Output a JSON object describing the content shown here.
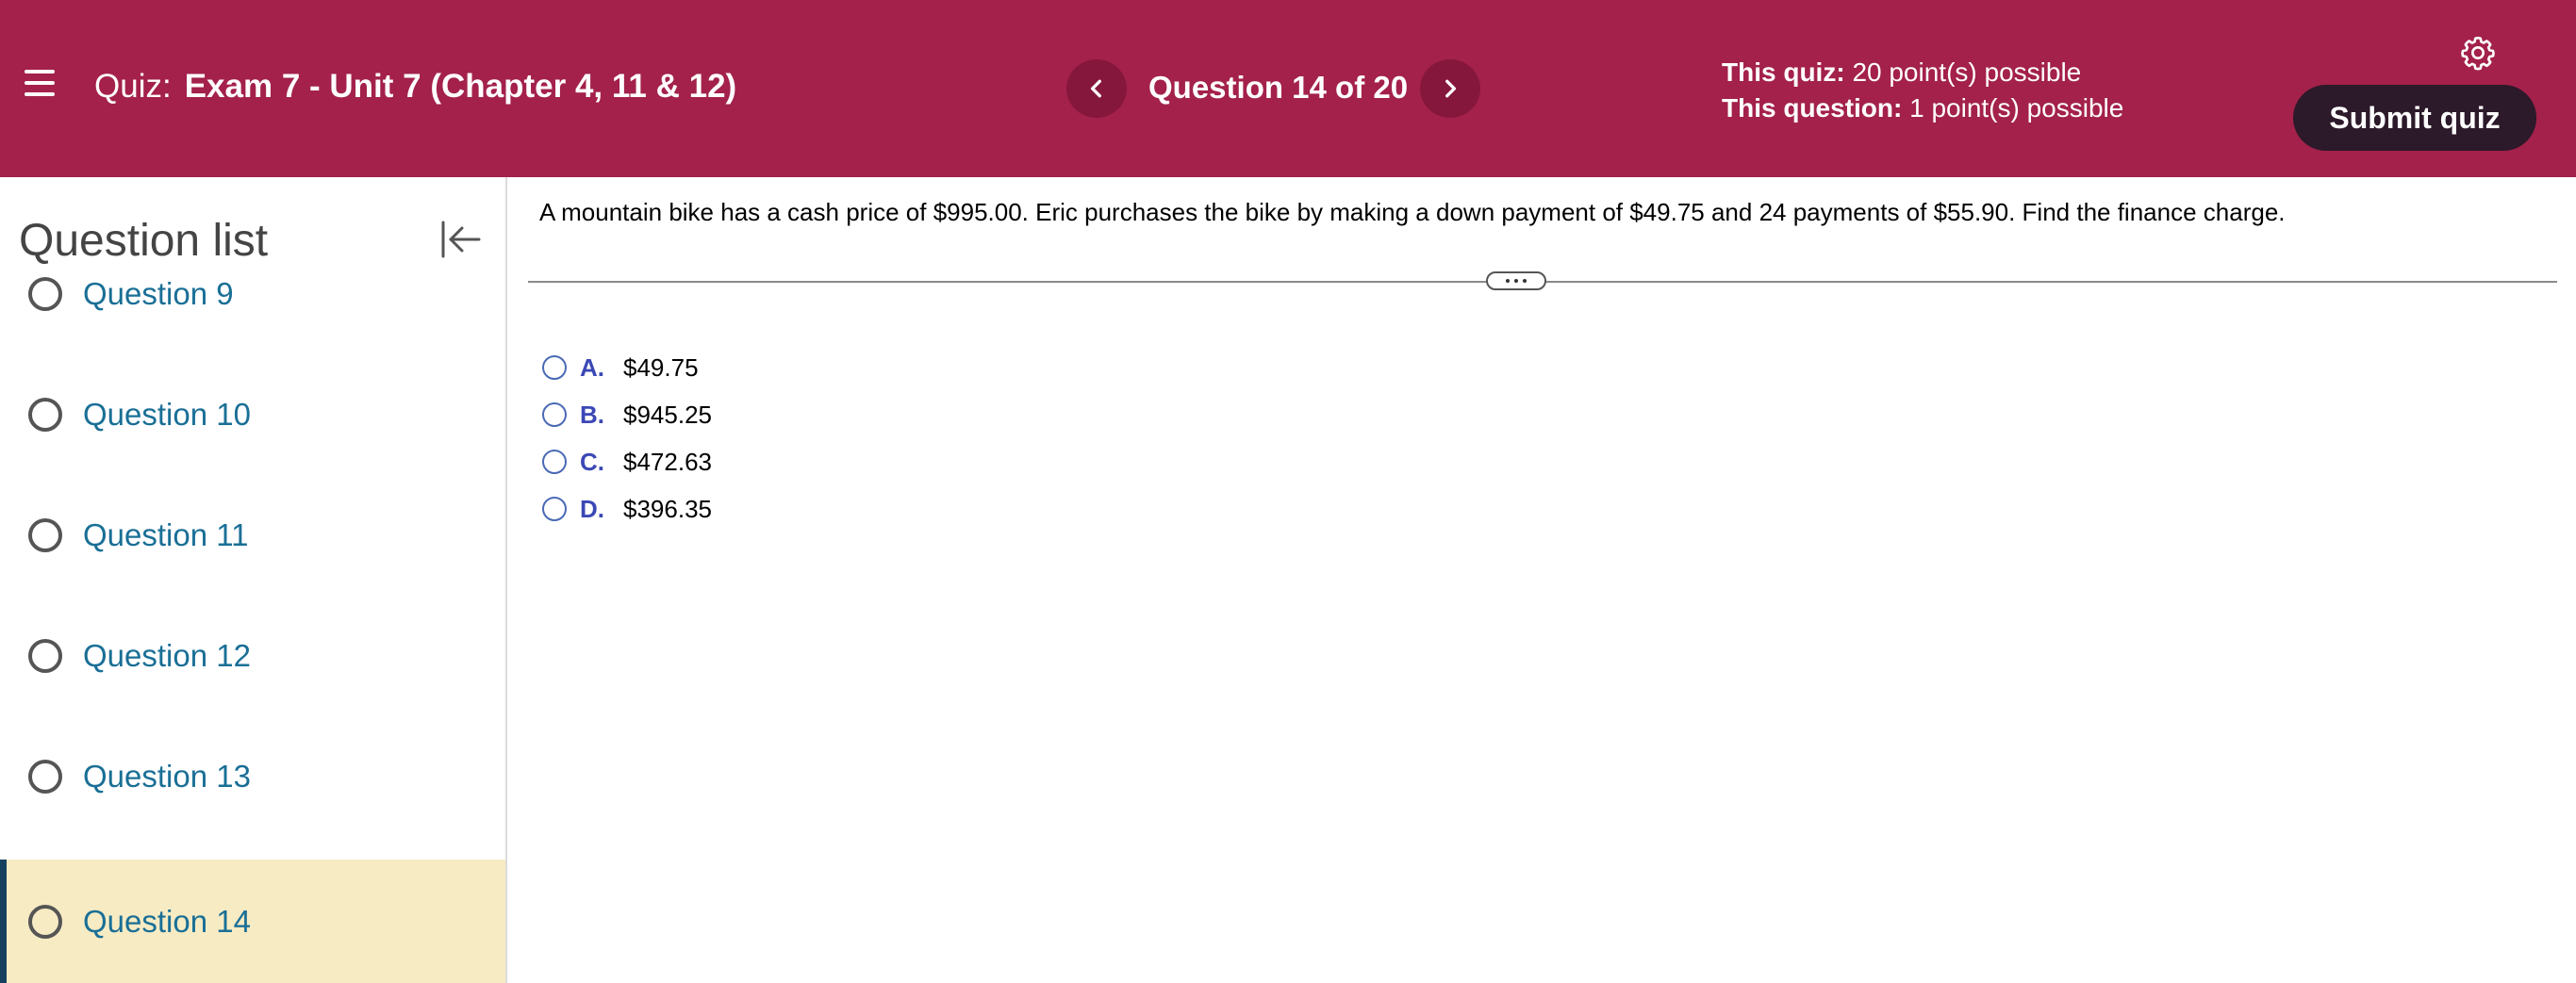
{
  "header": {
    "quiz_prefix": "Quiz:",
    "quiz_name": "Exam 7 - Unit 7 (Chapter 4, 11 & 12)",
    "question_counter": "Question 14 of 20",
    "this_quiz_label": "This quiz:",
    "this_quiz_value": "20 point(s) possible",
    "this_question_label": "This question:",
    "this_question_value": "1 point(s) possible",
    "submit_label": "Submit quiz",
    "colors": {
      "bar": "#a3214b",
      "nav_button": "#86173c",
      "submit": "#2c1929"
    }
  },
  "sidebar": {
    "title": "Question list",
    "items": [
      {
        "label": "Question 9"
      },
      {
        "label": "Question 10"
      },
      {
        "label": "Question 11"
      },
      {
        "label": "Question 12"
      },
      {
        "label": "Question 13"
      },
      {
        "label": "Question 14",
        "active": true
      }
    ]
  },
  "main": {
    "question": "A mountain bike has a cash price of $995.00. Eric purchases the bike by making a down payment of $49.75 and 24 payments of $55.90. Find the finance charge.",
    "options": [
      {
        "letter": "A.",
        "value": "$49.75"
      },
      {
        "letter": "B.",
        "value": "$945.25"
      },
      {
        "letter": "C.",
        "value": "$472.63"
      },
      {
        "letter": "D.",
        "value": "$396.35"
      }
    ]
  },
  "icons": [
    "menu-icon",
    "chevron-left-icon",
    "chevron-right-icon",
    "gear-icon",
    "collapse-left-icon"
  ]
}
